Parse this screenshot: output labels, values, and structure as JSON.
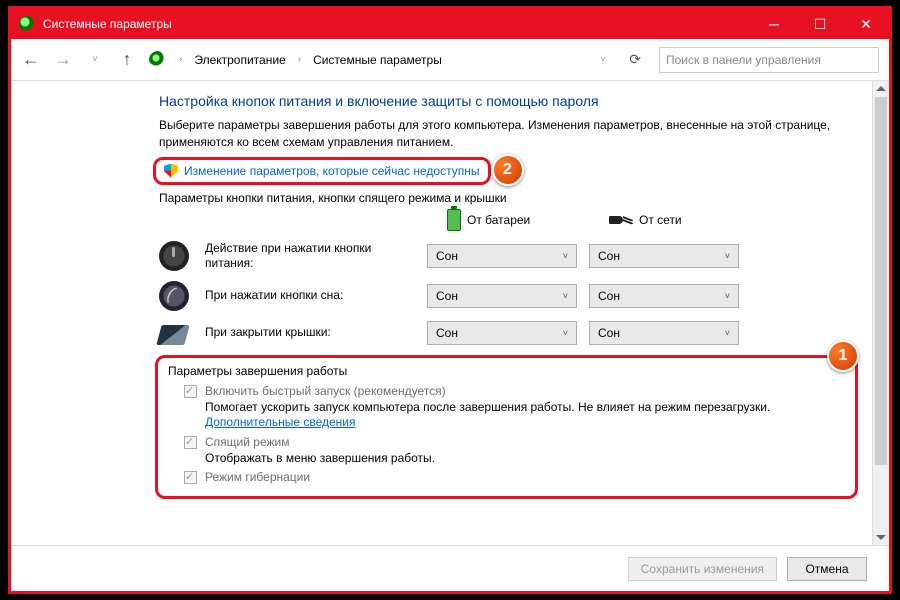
{
  "window": {
    "title": "Системные параметры"
  },
  "nav": {
    "crumb1": "Электропитание",
    "crumb2": "Системные параметры",
    "search_placeholder": "Поиск в панели управления"
  },
  "page": {
    "heading": "Настройка кнопок питания и включение защиты с помощью пароля",
    "subtext": "Выберите параметры завершения работы для этого компьютера. Изменения параметров, внесенные на этой странице, применяются ко всем схемам управления питанием.",
    "uac_link": "Изменение параметров, которые сейчас недоступны",
    "section_label": "Параметры кнопки питания, кнопки спящего режима и крышки"
  },
  "columns": {
    "battery": "От батареи",
    "plugged": "От сети"
  },
  "rows": {
    "power": "Действие при нажатии кнопки питания:",
    "sleep": "При нажатии кнопки сна:",
    "lid": "При закрытии крышки:"
  },
  "combo_value": "Сон",
  "shutdown": {
    "title": "Параметры завершения работы",
    "fast_label": "Включить быстрый запуск (рекомендуется)",
    "fast_desc_a": "Помогает ускорить запуск компьютера после завершения работы. Не влияет на режим перезагрузки. ",
    "fast_desc_link": "Дополнительные сведения",
    "sleep_label": "Спящий режим",
    "sleep_desc": "Отображать в меню завершения работы.",
    "hiber_label": "Режим гибернации"
  },
  "buttons": {
    "save": "Сохранить изменения",
    "cancel": "Отмена"
  },
  "callouts": {
    "one": "1",
    "two": "2"
  }
}
